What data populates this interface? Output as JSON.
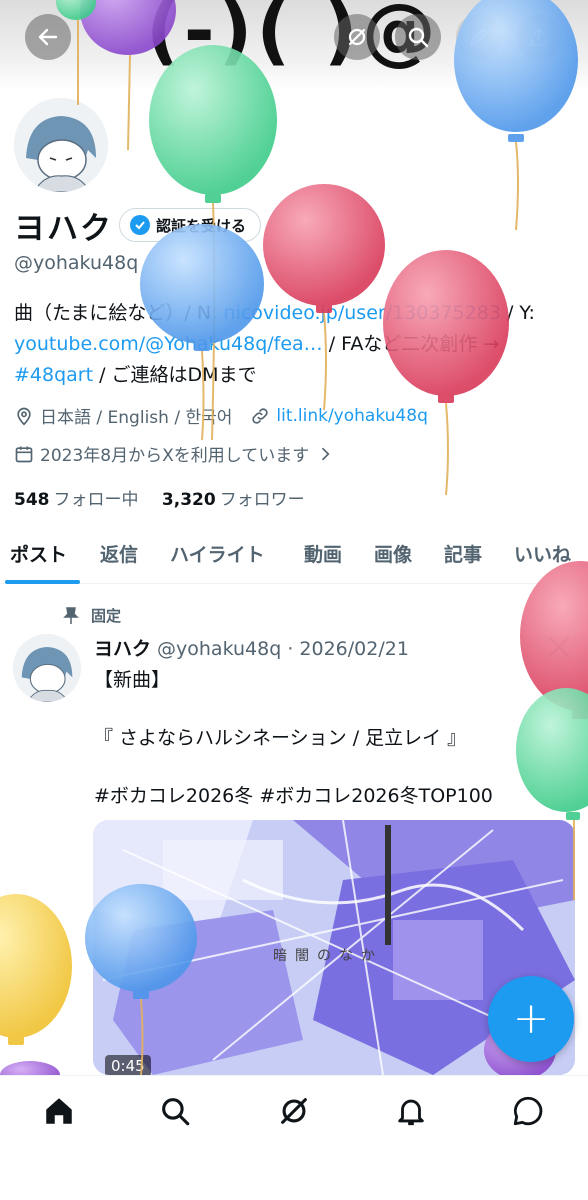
{
  "header": {
    "decorative_text": "(-)( )@",
    "buttons": [
      "back",
      "grok",
      "search",
      "edit",
      "share"
    ]
  },
  "profile": {
    "display_name": "ヨハク",
    "verify_button": "認証を受ける",
    "handle": "@yohaku48q",
    "bio": {
      "p1": "曲（たまに絵など）/ N: ",
      "link1": "nicovideo.jp/user/130375283",
      "p2": " / Y: ",
      "link2": "youtube.com/@Yohaku48q/fea…",
      "p3": " / FAなど二次創作 → ",
      "link3": "#48qart",
      "p4": " / ご連絡はDMまで"
    },
    "location": "日本語 / English / 한국어",
    "website": "lit.link/yohaku48q",
    "joined": "2023年8月からXを利用しています",
    "following_count": "548",
    "following_label": "フォロー中",
    "followers_count": "3,320",
    "followers_label": "フォロワー"
  },
  "tabs": [
    "ポスト",
    "返信",
    "ハイライト",
    "動画",
    "画像",
    "記事",
    "いいね"
  ],
  "post": {
    "pinned_label": "固定",
    "author_name": "ヨハク",
    "author_handle": "@yohaku48q",
    "date": "2026/02/21",
    "line1": "【新曲】",
    "line2": "『 さよならハルシネーション / 足立レイ 』",
    "hashtags": "#ボカコレ2026冬 #ボカコレ2026冬TOP100",
    "video_duration": "0:45",
    "media_caption": "暗闇のなか"
  },
  "fab_icon": "+",
  "bottom_nav": [
    "home-icon",
    "search-icon",
    "grok-icon",
    "notifications-icon",
    "messages-icon"
  ],
  "colors": {
    "accent": "#1d9bf0",
    "balloon_green": "#5fd6a4",
    "balloon_blue": "#6fb1f3",
    "balloon_red": "#e4506a",
    "balloon_yellow": "#f4cd4a",
    "balloon_purple": "#9b59d8"
  }
}
